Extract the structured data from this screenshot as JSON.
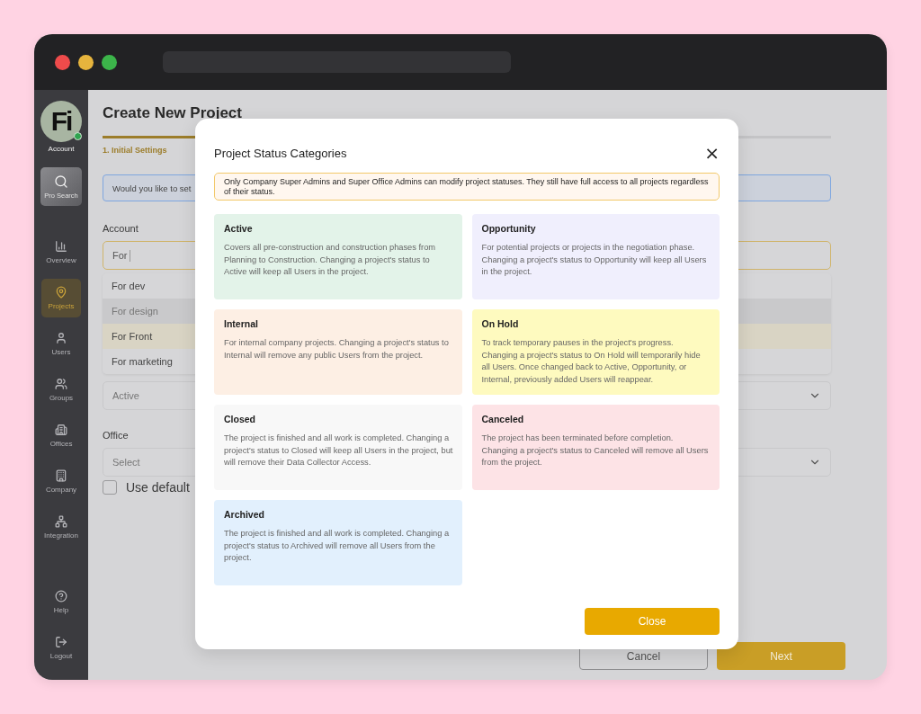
{
  "sidebar": {
    "account": {
      "logo_text": "Fi",
      "label": "Account",
      "online": true
    },
    "pro_search": {
      "label": "Pro Search"
    },
    "items": [
      {
        "kind": "overview",
        "label": "Overview",
        "selected": false
      },
      {
        "kind": "projects",
        "label": "Projects",
        "selected": true
      },
      {
        "kind": "users",
        "label": "Users",
        "selected": false
      },
      {
        "kind": "groups",
        "label": "Groups",
        "selected": false
      },
      {
        "kind": "offices",
        "label": "Offices",
        "selected": false
      },
      {
        "kind": "company",
        "label": "Company",
        "selected": false
      },
      {
        "kind": "integration",
        "label": "Integration",
        "selected": false
      }
    ],
    "bottom_items": [
      {
        "kind": "help",
        "label": "Help"
      },
      {
        "kind": "logout",
        "label": "Logout"
      }
    ]
  },
  "page": {
    "title": "Create New Project",
    "progress": {
      "level": 0.23
    },
    "step": "1. Initial Settings",
    "info": "Would you like to set",
    "account": {
      "label": "Account",
      "value": "For",
      "options": [
        {
          "label": "For dev",
          "hovered": false,
          "selected": false
        },
        {
          "label": "For design",
          "hovered": true,
          "selected": false
        },
        {
          "label": "For Front",
          "hovered": false,
          "selected": true
        },
        {
          "label": "For marketing",
          "hovered": false,
          "selected": false
        }
      ]
    },
    "status_select": {
      "value": "Active"
    },
    "office": {
      "label": "Office",
      "placeholder": "Select"
    },
    "default_checkbox": {
      "label": "Use default",
      "checked": false
    },
    "buttons": {
      "cancel": "Cancel",
      "next": "Next"
    }
  },
  "modal": {
    "title": "Project Status Categories",
    "close_icon": "×",
    "notice": "Only Company Super Admins and Super Office Admins can modify project statuses. They still have full access to all projects regardless of their status.",
    "categories": [
      {
        "name": "Active",
        "color": "#e3f3e9",
        "description": "Covers all pre-construction and construction phases from Planning to Construction. Changing a project's status to Active will keep all Users in the project."
      },
      {
        "name": "Opportunity",
        "color": "#f0effd",
        "description": "For potential projects or projects in the negotiation phase. Changing a project's status to Opportunity will keep all Users in the project."
      },
      {
        "name": "Internal",
        "color": "#fdefe4",
        "description": "For internal company projects. Changing a project's status to Internal will remove any public Users from the project."
      },
      {
        "name": "On Hold",
        "color": "#fefabf",
        "description": "To track temporary pauses in the project's progress. Changing a project's status to On Hold will temporarily hide all Users. Once changed back to Active, Opportunity, or Internal, previously added Users will reappear."
      },
      {
        "name": "Closed",
        "color": "#f8f8f8",
        "description": "The project is finished and all work is completed. Changing a project's status to Closed will keep all Users in the project, but will remove their Data Collector Access."
      },
      {
        "name": "Canceled",
        "color": "#fde3e6",
        "description": "The project has been terminated before completion. Changing a project's status to Canceled will remove all Users from the project."
      },
      {
        "name": "Archived",
        "color": "#e2f0fd",
        "description": "The project is finished and all work is completed. Changing a project's status to Archived will remove all Users from the project."
      }
    ],
    "close_button": "Close"
  }
}
